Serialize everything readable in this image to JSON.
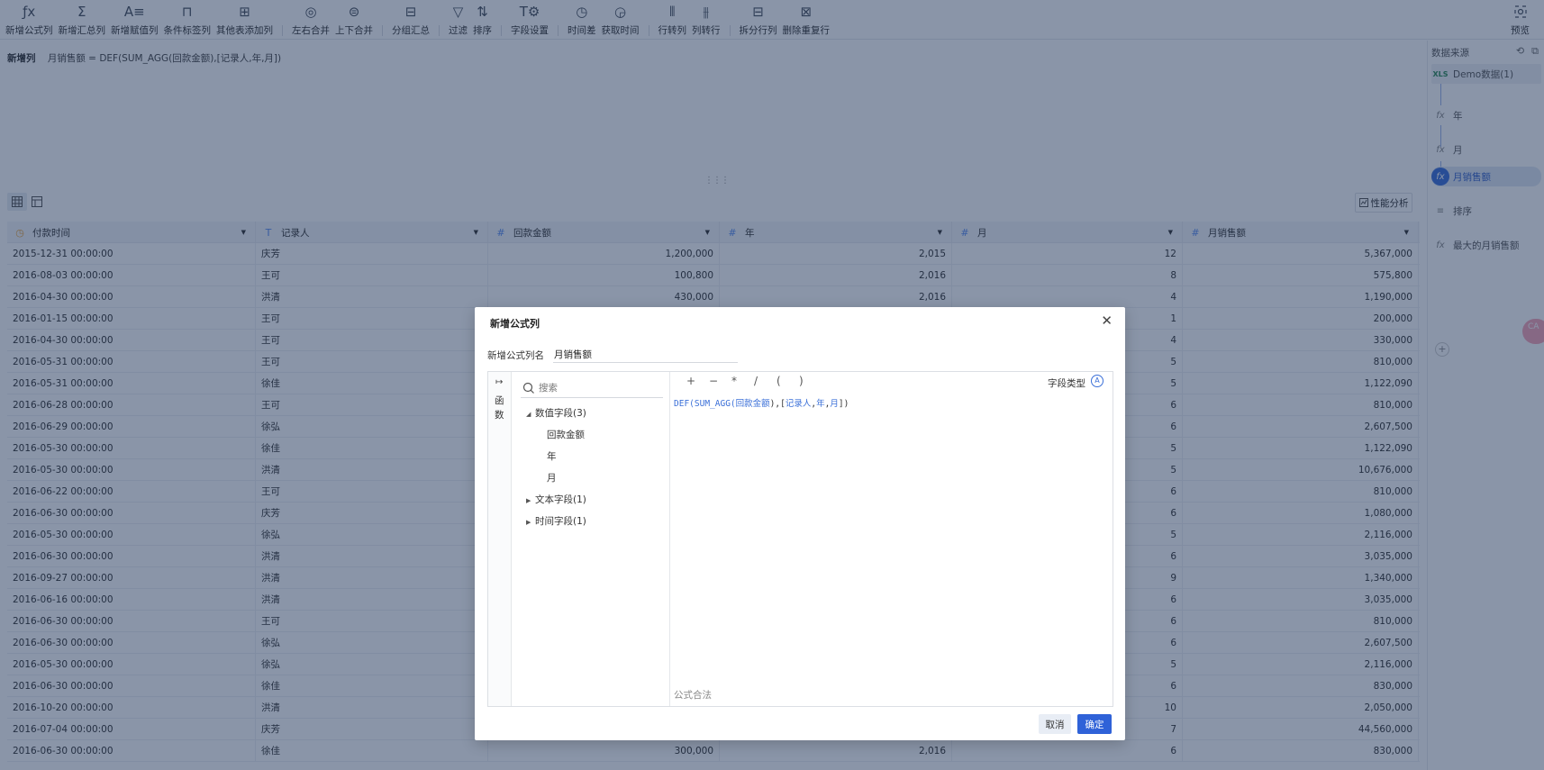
{
  "toolbar": {
    "buttons": [
      {
        "label": "新增公式列",
        "icon": "formula-icon"
      },
      {
        "label": "新增汇总列",
        "icon": "sigma-icon"
      },
      {
        "label": "新增赋值列",
        "icon": "assign-icon"
      },
      {
        "label": "条件标签列",
        "icon": "condition-tag-icon"
      },
      {
        "label": "其他表添加列",
        "icon": "add-from-table-icon"
      },
      {
        "label": "左右合并",
        "icon": "merge-horizontal-icon"
      },
      {
        "label": "上下合并",
        "icon": "merge-vertical-icon"
      },
      {
        "label": "分组汇总",
        "icon": "group-summary-icon"
      },
      {
        "label": "过滤",
        "icon": "filter-icon"
      },
      {
        "label": "排序",
        "icon": "sort-icon"
      },
      {
        "label": "字段设置",
        "icon": "field-settings-icon"
      },
      {
        "label": "时间差",
        "icon": "time-diff-icon"
      },
      {
        "label": "获取时间",
        "icon": "get-time-icon"
      },
      {
        "label": "行转列",
        "icon": "row-to-column-icon"
      },
      {
        "label": "列转行",
        "icon": "column-to-row-icon"
      },
      {
        "label": "拆分行列",
        "icon": "split-icon"
      },
      {
        "label": "删除重复行",
        "icon": "dedupe-icon"
      }
    ],
    "preview_label": "预览"
  },
  "formula_bar": {
    "tag": "新增列",
    "formula": "月销售额 = DEF(SUM_AGG(回款金额),[记录人,年,月])"
  },
  "perf_label": "性能分析",
  "grid": {
    "columns": [
      {
        "name": "付款时间",
        "type": "time"
      },
      {
        "name": "记录人",
        "type": "text"
      },
      {
        "name": "回款金额",
        "type": "number"
      },
      {
        "name": "年",
        "type": "number"
      },
      {
        "name": "月",
        "type": "number"
      },
      {
        "name": "月销售额",
        "type": "number"
      }
    ],
    "rows": [
      [
        "2015-12-31 00:00:00",
        "庆芳",
        "1,200,000",
        "2,015",
        "12",
        "5,367,000"
      ],
      [
        "2016-08-03 00:00:00",
        "王可",
        "100,800",
        "2,016",
        "8",
        "575,800"
      ],
      [
        "2016-04-30 00:00:00",
        "洪清",
        "430,000",
        "2,016",
        "4",
        "1,190,000"
      ],
      [
        "2016-01-15 00:00:00",
        "王可",
        "",
        "",
        "1",
        "200,000"
      ],
      [
        "2016-04-30 00:00:00",
        "王可",
        "",
        "",
        "4",
        "330,000"
      ],
      [
        "2016-05-31 00:00:00",
        "王可",
        "",
        "",
        "5",
        "810,000"
      ],
      [
        "2016-05-31 00:00:00",
        "徐佳",
        "",
        "",
        "5",
        "1,122,090"
      ],
      [
        "2016-06-28 00:00:00",
        "王可",
        "",
        "",
        "6",
        "810,000"
      ],
      [
        "2016-06-29 00:00:00",
        "徐弘",
        "",
        "",
        "6",
        "2,607,500"
      ],
      [
        "2016-05-30 00:00:00",
        "徐佳",
        "",
        "",
        "5",
        "1,122,090"
      ],
      [
        "2016-05-30 00:00:00",
        "洪清",
        "",
        "",
        "5",
        "10,676,000"
      ],
      [
        "2016-06-22 00:00:00",
        "王可",
        "",
        "",
        "6",
        "810,000"
      ],
      [
        "2016-06-30 00:00:00",
        "庆芳",
        "",
        "",
        "6",
        "1,080,000"
      ],
      [
        "2016-05-30 00:00:00",
        "徐弘",
        "",
        "",
        "5",
        "2,116,000"
      ],
      [
        "2016-06-30 00:00:00",
        "洪清",
        "",
        "",
        "6",
        "3,035,000"
      ],
      [
        "2016-09-27 00:00:00",
        "洪清",
        "",
        "",
        "9",
        "1,340,000"
      ],
      [
        "2016-06-16 00:00:00",
        "洪清",
        "",
        "",
        "6",
        "3,035,000"
      ],
      [
        "2016-06-30 00:00:00",
        "王可",
        "",
        "",
        "6",
        "810,000"
      ],
      [
        "2016-06-30 00:00:00",
        "徐弘",
        "",
        "",
        "6",
        "2,607,500"
      ],
      [
        "2016-05-30 00:00:00",
        "徐弘",
        "",
        "",
        "5",
        "2,116,000"
      ],
      [
        "2016-06-30 00:00:00",
        "徐佳",
        "",
        "",
        "6",
        "830,000"
      ],
      [
        "2016-10-20 00:00:00",
        "洪清",
        "",
        "",
        "10",
        "2,050,000"
      ],
      [
        "2016-07-04 00:00:00",
        "庆芳",
        "",
        "",
        "7",
        "44,560,000"
      ],
      [
        "2016-06-30 00:00:00",
        "徐佳",
        "300,000",
        "2,016",
        "6",
        "830,000"
      ]
    ]
  },
  "right_panel": {
    "title": "数据来源",
    "source_badge": "XLS",
    "source": "Demo数据(1)",
    "steps": [
      {
        "label": "年",
        "icon": "fx"
      },
      {
        "label": "月",
        "icon": "fx"
      },
      {
        "label": "月销售额",
        "icon": "fx",
        "active": true
      },
      {
        "label": "排序",
        "icon": "≡"
      },
      {
        "label": "最大的月销售额",
        "icon": "fx"
      }
    ],
    "add_label": "+"
  },
  "side_badge": "CA",
  "modal": {
    "title": "新增公式列",
    "name_label": "新增公式列名",
    "name_value": "月销售额",
    "fn_tab_label": "函数",
    "search_placeholder": "搜索",
    "tree": {
      "numeric_group": "数值字段(3)",
      "numeric_items": [
        "回款金额",
        "年",
        "月"
      ],
      "text_group": "文本字段(1)",
      "time_group": "时间字段(1)"
    },
    "operators": [
      "+",
      "−",
      "*",
      "/",
      "(",
      ")"
    ],
    "type_label": "字段类型",
    "code": {
      "fn": "DEF(SUM_AGG(",
      "arg1": "回款金额",
      "mid": "),[",
      "f1": "记录人",
      "f2": "年",
      "f3": "月",
      "end": "])"
    },
    "valid_text": "公式合法",
    "cancel_label": "取消",
    "ok_label": "确定"
  }
}
